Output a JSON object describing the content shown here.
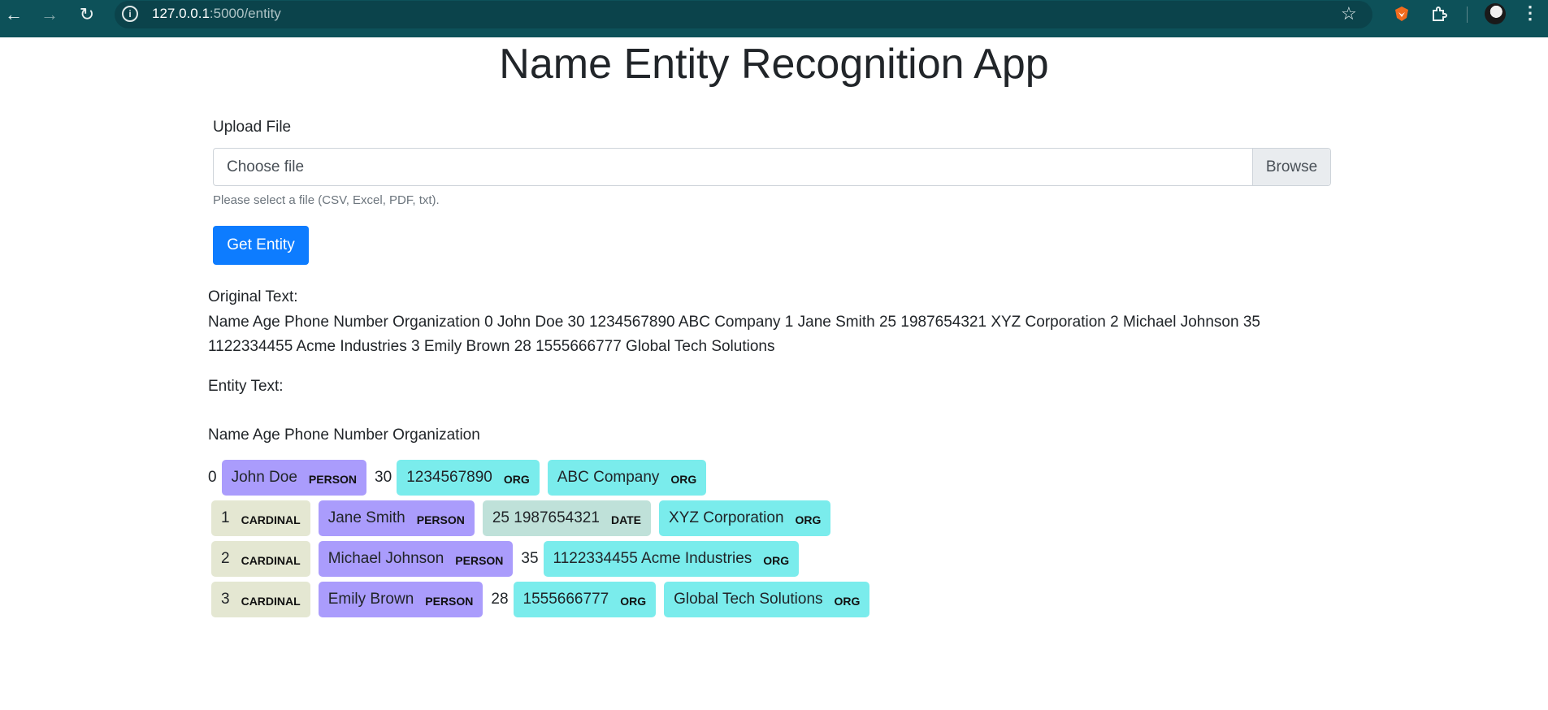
{
  "browser": {
    "url_host": "127.0.0.1",
    "url_path": ":5000/entity"
  },
  "page": {
    "title": "Name Entity Recognition App",
    "upload_label": "Upload File",
    "file_placeholder": "Choose file",
    "browse_label": "Browse",
    "help_text": "Please select a file (CSV, Excel, PDF, txt).",
    "submit_label": "Get Entity",
    "original_label": "Original Text:",
    "original_text": "Name Age Phone Number Organization 0 John Doe 30 1234567890 ABC Company 1 Jane Smith 25 1987654321 XYZ Corporation 2 Michael Johnson 35 1122334455 Acme Industries 3 Emily Brown 28 1555666777 Global Tech Solutions",
    "entity_label": "Entity Text:",
    "header_line": "Name Age Phone Number Organization"
  },
  "entity_colors": {
    "PERSON": "#aa9cfc",
    "ORG": "#7aecec",
    "CARDINAL": "#e4e7d2",
    "DATE": "#bfe1d9"
  },
  "entity_lines": [
    [
      {
        "text": "0"
      },
      {
        "text": "John Doe",
        "label": "PERSON"
      },
      {
        "text": "30"
      },
      {
        "text": "1234567890",
        "label": "ORG"
      },
      {
        "text": "ABC Company",
        "label": "ORG"
      }
    ],
    [
      {
        "text": "1",
        "label": "CARDINAL"
      },
      {
        "text": "Jane Smith",
        "label": "PERSON"
      },
      {
        "text": "25 1987654321",
        "label": "DATE"
      },
      {
        "text": "XYZ Corporation",
        "label": "ORG"
      }
    ],
    [
      {
        "text": "2",
        "label": "CARDINAL"
      },
      {
        "text": "Michael Johnson",
        "label": "PERSON"
      },
      {
        "text": "35"
      },
      {
        "text": "1122334455 Acme Industries",
        "label": "ORG"
      }
    ],
    [
      {
        "text": "3",
        "label": "CARDINAL"
      },
      {
        "text": "Emily Brown",
        "label": "PERSON"
      },
      {
        "text": "28"
      },
      {
        "text": "1555666777",
        "label": "ORG"
      },
      {
        "text": "Global Tech Solutions",
        "label": "ORG"
      }
    ]
  ]
}
